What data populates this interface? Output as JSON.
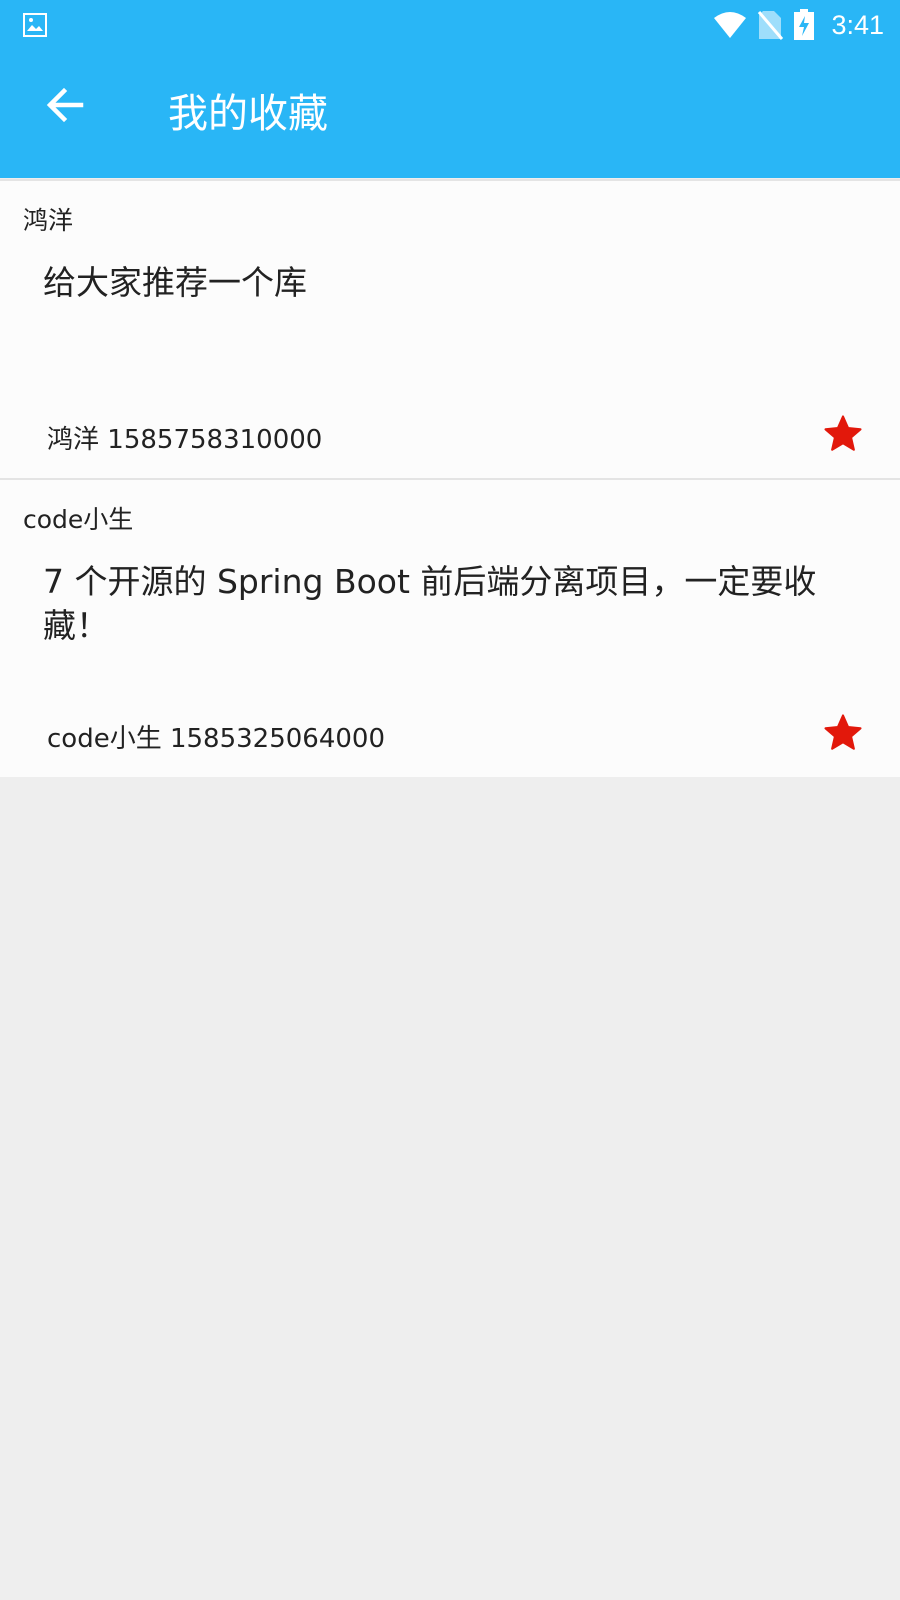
{
  "status_bar": {
    "time": "3:41",
    "left_icon": "image-notification-icon",
    "icons": [
      "wifi-icon",
      "no-sim-icon",
      "battery-charging-icon"
    ],
    "color": "#29b6f6"
  },
  "app_bar": {
    "title": "我的收藏",
    "back_icon": "arrow-back-icon",
    "color": "#29b6f6"
  },
  "favorites": [
    {
      "author": "鸿洋",
      "title": "给大家推荐一个库",
      "meta_author": "鸿洋",
      "timestamp": "1585758310000",
      "star_icon": "star-filled-icon",
      "star_color": "#e2180b"
    },
    {
      "author": "code小生",
      "title": "7 个开源的 Spring Boot 前后端分离项目，一定要收藏！",
      "meta_author": "code小生",
      "timestamp": "1585325064000",
      "star_icon": "star-filled-icon",
      "star_color": "#e2180b"
    }
  ]
}
